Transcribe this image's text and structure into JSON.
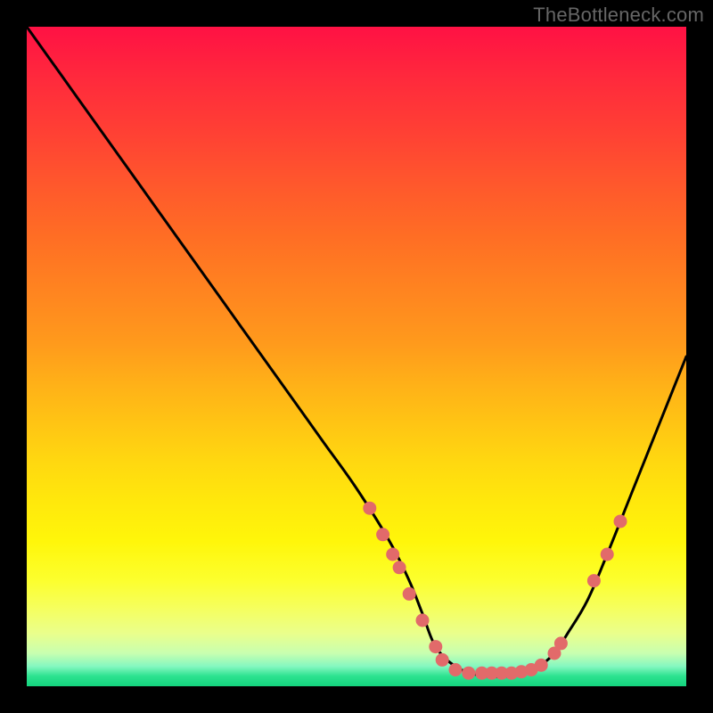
{
  "watermark": "TheBottleneck.com",
  "colors": {
    "dot": "#e26a6a",
    "curve": "#000000",
    "frame_bg": "#000000"
  },
  "chart_data": {
    "type": "line",
    "title": "",
    "xlabel": "",
    "ylabel": "",
    "xlim": [
      0,
      100
    ],
    "ylim": [
      0,
      100
    ],
    "grid": false,
    "legend": false,
    "note": "Valley-shaped bottleneck curve. y ≈ mismatch percentage (0 = perfect balance, bottom green band). Minimum plateau roughly x∈[62,77] at y≈2. Axes/ticks not drawn in source image; values are read off the normalized plot box.",
    "series": [
      {
        "name": "bottleneck-curve",
        "x": [
          0,
          5,
          10,
          15,
          20,
          25,
          30,
          35,
          40,
          45,
          50,
          55,
          58,
          60,
          62,
          65,
          68,
          70,
          73,
          75,
          77,
          80,
          82,
          85,
          88,
          92,
          96,
          100
        ],
        "y": [
          100,
          93,
          86,
          79,
          72,
          65,
          58,
          51,
          44,
          37,
          30,
          22,
          16,
          11,
          6,
          3,
          1.8,
          1.5,
          1.5,
          1.8,
          2.5,
          5,
          8,
          13,
          20,
          30,
          40,
          50
        ]
      }
    ],
    "markers": [
      {
        "x": 52,
        "y": 27
      },
      {
        "x": 54,
        "y": 23
      },
      {
        "x": 55.5,
        "y": 20
      },
      {
        "x": 56.5,
        "y": 18
      },
      {
        "x": 58,
        "y": 14
      },
      {
        "x": 60,
        "y": 10
      },
      {
        "x": 62,
        "y": 6
      },
      {
        "x": 63,
        "y": 4
      },
      {
        "x": 65,
        "y": 2.5
      },
      {
        "x": 67,
        "y": 2
      },
      {
        "x": 69,
        "y": 2
      },
      {
        "x": 70.5,
        "y": 2
      },
      {
        "x": 72,
        "y": 2
      },
      {
        "x": 73.5,
        "y": 2
      },
      {
        "x": 75,
        "y": 2.2
      },
      {
        "x": 76.5,
        "y": 2.5
      },
      {
        "x": 78,
        "y": 3.2
      },
      {
        "x": 80,
        "y": 5
      },
      {
        "x": 81,
        "y": 6.5
      },
      {
        "x": 86,
        "y": 16
      },
      {
        "x": 88,
        "y": 20
      },
      {
        "x": 90,
        "y": 25
      }
    ]
  }
}
